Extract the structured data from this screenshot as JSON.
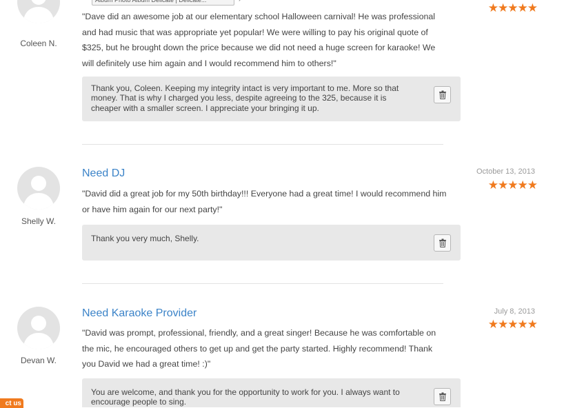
{
  "top_tag": {
    "label": "Album Photo Album Delicate | Delicate..."
  },
  "reviews": [
    {
      "reviewer": "Coleen N.",
      "title": "",
      "date": "",
      "stars": "★★★★★",
      "text": "\"Dave did an awesome job at our elementary school Halloween carnival! He was professional and had music that was appropriate yet popular! We were willing to pay his original quote of $325, but he brought down the price because we did not need a huge screen for karaoke! We will definitely use him again and I would recommend him to others!\"",
      "reply": "Thank you, Coleen. Keeping my integrity intact is very important to me. More so that money. That is why I charged you less, despite agreeing to the 325, because it is cheaper with a smaller screen. I appreciate your bringing it up."
    },
    {
      "reviewer": "Shelly W.",
      "title": "Need DJ",
      "date": "October 13, 2013",
      "stars": "★★★★★",
      "text": "\"David did a great job for my 50th birthday!!! Everyone had a great time! I would recommend him or have him again for our next party!\"",
      "reply": "Thank you very much, Shelly."
    },
    {
      "reviewer": "Devan W.",
      "title": "Need Karaoke Provider",
      "date": "July 8, 2013",
      "stars": "★★★★★",
      "text": "\"David was prompt, professional, friendly, and a great singer! Because he was comfortable on the mic, he encouraged others to get up and get the party started. Highly recommend! Thank you David we had a great time! :)\"",
      "reply": "You are welcome, and thank you for the opportunity to work for you. I always want to encourage people to sing."
    }
  ],
  "contact_tab": {
    "label": "ct us"
  },
  "colors": {
    "accent": "#3b83c8",
    "stars": "#f07a1e",
    "reply_bg": "#e8e8e8"
  },
  "icons": {
    "avatar": "user-silhouette-icon",
    "delete": "trash-icon",
    "rating": "star-icon"
  }
}
